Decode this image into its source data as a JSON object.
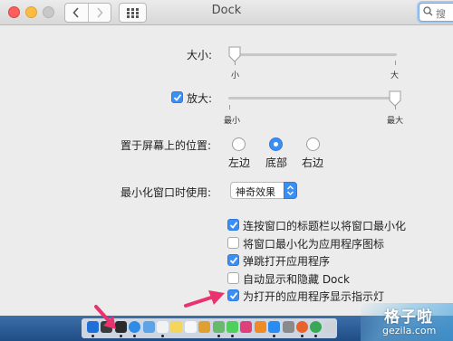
{
  "window": {
    "title": "Dock"
  },
  "search": {
    "placeholder": "搜"
  },
  "size": {
    "label": "大小:",
    "min_label": "小",
    "max_label": "大",
    "level": 0.0
  },
  "magnification": {
    "label": "放大:",
    "checked": true,
    "min_label": "最小",
    "max_label": "最大",
    "level": 1.0
  },
  "position": {
    "label": "置于屏幕上的位置:",
    "options": [
      {
        "label": "左边",
        "selected": false
      },
      {
        "label": "底部",
        "selected": true
      },
      {
        "label": "右边",
        "selected": false
      }
    ]
  },
  "minimize": {
    "label": "最小化窗口时使用:",
    "value": "神奇效果"
  },
  "options": [
    {
      "label": "连按窗口的标题栏以将窗口最小化",
      "checked": true
    },
    {
      "label": "将窗口最小化为应用程序图标",
      "checked": false
    },
    {
      "label": "弹跳打开应用程序",
      "checked": true
    },
    {
      "label": "自动显示和隐藏 Dock",
      "checked": false
    },
    {
      "label": "为打开的应用程序显示指示灯",
      "checked": true
    }
  ],
  "dock": {
    "icons": [
      "finder-icon",
      "launchpad-icon",
      "qq-icon",
      "safari-icon",
      "mail-icon",
      "calendar-icon",
      "notes-icon",
      "reminders-icon",
      "photos-icon",
      "maps-icon",
      "messages-icon",
      "itunes-icon",
      "ibooks-icon",
      "app-store-icon",
      "preferences-icon",
      "firefox-icon",
      "chrome-icon",
      "trash-icon"
    ]
  },
  "watermark": {
    "line1": "格子啦",
    "line2": "gezila.com"
  },
  "colors": {
    "accent": "#3a8ff3",
    "arrow": "#e8336f",
    "dock": "#2a5a93"
  }
}
